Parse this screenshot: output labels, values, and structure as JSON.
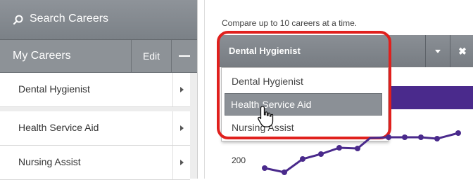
{
  "sidebar": {
    "search_label": "Search Careers",
    "search_icon": "search-icon",
    "my_careers_label": "My Careers",
    "edit_label": "Edit",
    "items": [
      {
        "label": "Dental Hygienist"
      },
      {
        "label": "Health Service Aid"
      },
      {
        "label": "Nursing Assist"
      }
    ]
  },
  "main": {
    "hint": "Compare up to 10 careers at a time.",
    "selected_career": "Dental Hygienist",
    "dropdown_options": [
      {
        "label": "Dental Hygienist"
      },
      {
        "label": "Health Service Aid"
      },
      {
        "label": "Nursing Assist"
      }
    ],
    "hovered_option": "Health Service Aid",
    "chart_y_label": "200"
  },
  "colors": {
    "sidebar_header": "#8d9297",
    "accent_purple": "#4a2a8c",
    "highlight_red": "#e0201d"
  }
}
